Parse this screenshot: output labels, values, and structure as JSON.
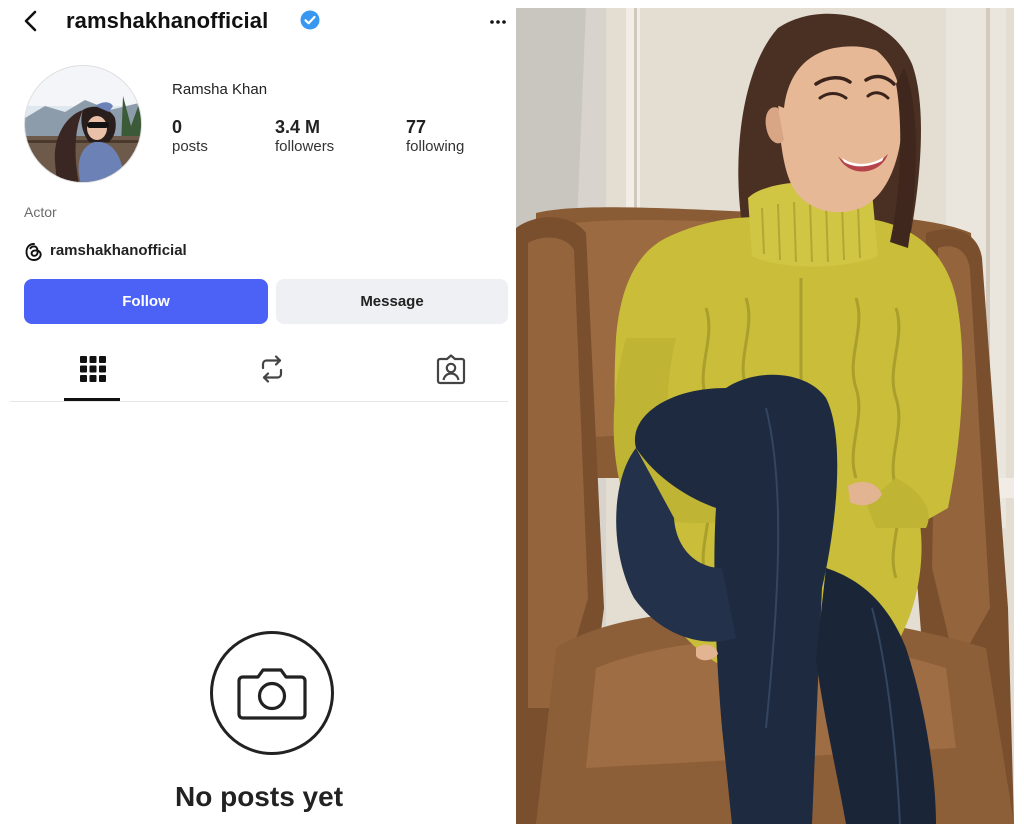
{
  "profile": {
    "username": "ramshakhanofficial",
    "display_name": "Ramsha Khan",
    "bio": "Actor",
    "threads_handle": "ramshakhanofficial",
    "verified": true,
    "stats": [
      {
        "value": "0",
        "label": "posts"
      },
      {
        "value": "3.4 M",
        "label": "followers"
      },
      {
        "value": "77",
        "label": "following"
      }
    ]
  },
  "actions": {
    "follow_label": "Follow",
    "message_label": "Message"
  },
  "tabs": [
    {
      "icon": "grid-icon",
      "active": true
    },
    {
      "icon": "reposts-icon",
      "active": false
    },
    {
      "icon": "tagged-icon",
      "active": false
    }
  ],
  "empty_state": {
    "icon": "camera-icon",
    "text": "No posts yet"
  },
  "colors": {
    "follow_button": "#4c62f7",
    "message_button": "#eef0f3",
    "verified_badge": "#3897f0",
    "sweater": "#c9bd3a",
    "jeans": "#1e2a3f",
    "chair": "#8a5c36"
  }
}
